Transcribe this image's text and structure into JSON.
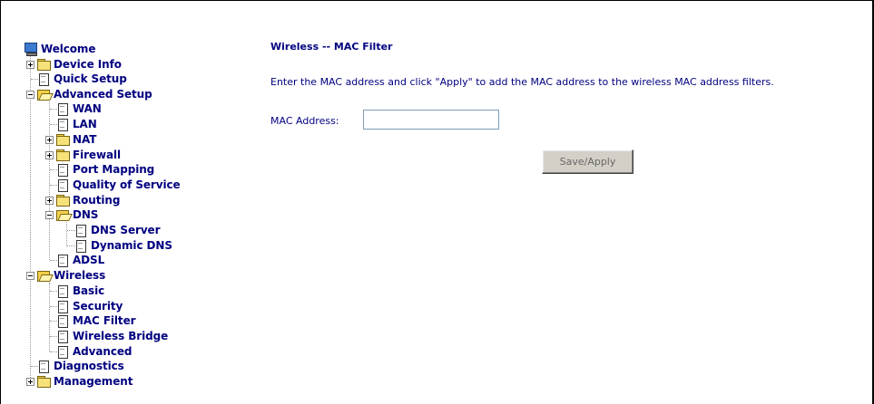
{
  "nav": {
    "welcome": "Welcome",
    "device_info": "Device Info",
    "quick_setup": "Quick Setup",
    "advanced_setup": "Advanced Setup",
    "wan": "WAN",
    "lan": "LAN",
    "nat": "NAT",
    "firewall": "Firewall",
    "port_mapping": "Port Mapping",
    "qos": "Quality of Service",
    "routing": "Routing",
    "dns": "DNS",
    "dns_server": "DNS Server",
    "dynamic_dns": "Dynamic DNS",
    "adsl": "ADSL",
    "wireless": "Wireless",
    "basic": "Basic",
    "security": "Security",
    "mac_filter": "MAC Filter",
    "wireless_bridge": "Wireless Bridge",
    "advanced": "Advanced",
    "diagnostics": "Diagnostics",
    "management": "Management"
  },
  "main": {
    "title": "Wireless -- MAC Filter",
    "instructions": "Enter the MAC address and click \"Apply\" to add the MAC address to the wireless MAC address filters.",
    "mac_label": "MAC Address:",
    "mac_value": "",
    "apply_label": "Save/Apply"
  },
  "colors": {
    "link": "#000080",
    "button_face": "#d4d0c8"
  },
  "icons": [
    "monitor-icon",
    "folder-icon",
    "folder-open-icon",
    "document-icon",
    "expand-icon",
    "collapse-icon"
  ]
}
